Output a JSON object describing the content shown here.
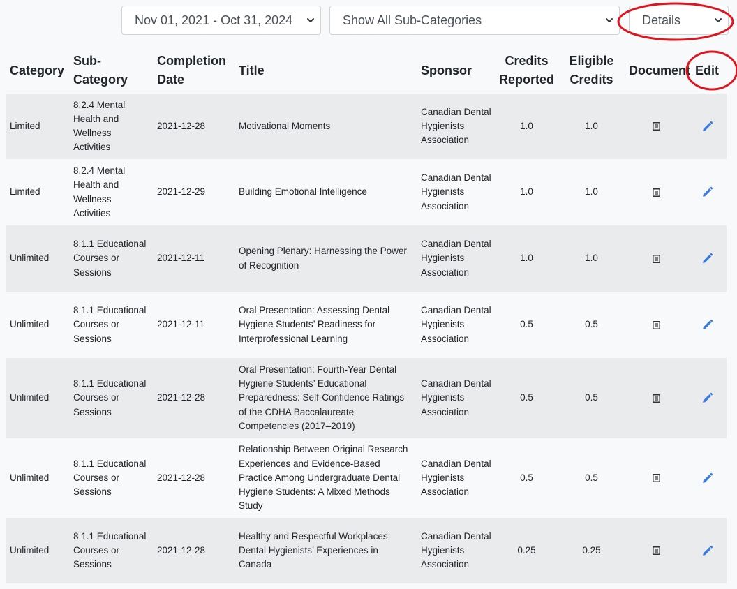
{
  "filters": {
    "date_range": "Nov 01, 2021 - Oct 31, 2024",
    "subcategory": "Show All Sub-Categories",
    "view_mode": "Details"
  },
  "icons": {
    "dropdown": "chevron-down-icon",
    "document": "document-icon",
    "edit": "pencil-icon"
  },
  "colors": {
    "highlight": "#e0141e",
    "edit_icon": "#3a7be0",
    "row_stripe": "#eaebed"
  },
  "table": {
    "headers": {
      "category": "Category",
      "subcategory_line1": "Sub-",
      "subcategory_line2": "Category",
      "completion_line1": "Completion",
      "completion_line2": "Date",
      "title": "Title",
      "sponsor": "Sponsor",
      "credits_line1": "Credits",
      "credits_line2": "Reported",
      "eligible_line1": "Eligible",
      "eligible_line2": "Credits",
      "document": "Document",
      "edit": "Edit"
    },
    "rows": [
      {
        "category": "Limited",
        "subcategory": "8.2.4 Mental Health and Wellness Activities",
        "date": "2021-12-28",
        "title": "Motivational Moments",
        "sponsor": "Canadian Dental Hygienists Association",
        "credits_reported": "1.0",
        "eligible_credits": "1.0"
      },
      {
        "category": "Limited",
        "subcategory": "8.2.4 Mental Health and Wellness Activities",
        "date": "2021-12-29",
        "title": "Building Emotional Intelligence",
        "sponsor": "Canadian Dental Hygienists Association",
        "credits_reported": "1.0",
        "eligible_credits": "1.0"
      },
      {
        "category": "Unlimited",
        "subcategory": "8.1.1 Educational Courses or Sessions",
        "date": "2021-12-11",
        "title": "Opening Plenary: Harnessing the Power of Recognition",
        "sponsor": "Canadian Dental Hygienists Association",
        "credits_reported": "1.0",
        "eligible_credits": "1.0"
      },
      {
        "category": "Unlimited",
        "subcategory": "8.1.1 Educational Courses or Sessions",
        "date": "2021-12-11",
        "title": "Oral Presentation: Assessing Dental Hygiene Students’ Readiness for Interprofessional Learning",
        "sponsor": "Canadian Dental Hygienists Association",
        "credits_reported": "0.5",
        "eligible_credits": "0.5"
      },
      {
        "category": "Unlimited",
        "subcategory": "8.1.1 Educational Courses or Sessions",
        "date": "2021-12-28",
        "title": "Oral Presentation: Fourth-Year Dental Hygiene Students’ Educational Preparedness: Self-Confidence Ratings of the CDHA Baccalaureate Competencies (2017–2019)",
        "sponsor": "Canadian Dental Hygienists Association",
        "credits_reported": "0.5",
        "eligible_credits": "0.5"
      },
      {
        "category": "Unlimited",
        "subcategory": "8.1.1 Educational Courses or Sessions",
        "date": "2021-12-28",
        "title": "Relationship Between Original Research Experiences and Evidence-Based Practice Among Undergraduate Dental Hygiene Students: A Mixed Methods Study",
        "sponsor": "Canadian Dental Hygienists Association",
        "credits_reported": "0.5",
        "eligible_credits": "0.5"
      },
      {
        "category": "Unlimited",
        "subcategory": "8.1.1 Educational Courses or Sessions",
        "date": "2021-12-28",
        "title": "Healthy and Respectful Workplaces: Dental Hygienists’ Experiences in Canada",
        "sponsor": "Canadian Dental Hygienists Association",
        "credits_reported": "0.25",
        "eligible_credits": "0.25"
      }
    ]
  }
}
